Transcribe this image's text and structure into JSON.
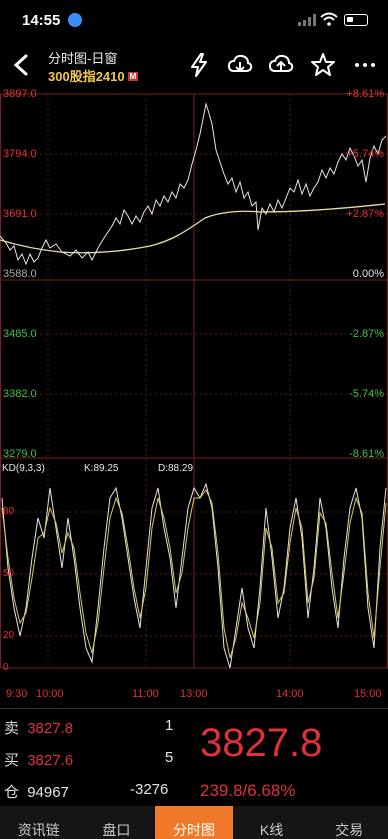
{
  "status": {
    "time": "14:55"
  },
  "header": {
    "title": "分时图-日窗",
    "subtitle": "300股指2410",
    "tag": "M"
  },
  "price_axis": {
    "left": [
      "3897.0",
      "3794.0",
      "3691.0",
      "3588.0",
      "3485.0",
      "3382.0",
      "3279.0"
    ],
    "right": [
      "+8.61%",
      "+5.74%",
      "+2.87%",
      "0.00%",
      "-2.87%",
      "-5.74%",
      "-8.61%"
    ]
  },
  "kd": {
    "label": "KD(9,3,3)",
    "k": "K:89.25",
    "d": "D:88.29",
    "levels": [
      "80",
      "50",
      "20",
      "0"
    ]
  },
  "time_axis": [
    "9:30",
    "10:00",
    "11:00",
    "13:00",
    "14:00",
    "15:00"
  ],
  "quote": {
    "sell_label": "卖",
    "sell_price": "3827.8",
    "sell_qty": "1",
    "buy_label": "买",
    "buy_price": "3827.6",
    "buy_qty": "5",
    "pos_label": "仓",
    "pos_value": "94967",
    "pos_change": "-3276",
    "last_price": "3827.8",
    "change": "239.8/6.68%"
  },
  "tabs": [
    "资讯链",
    "盘口",
    "分时图",
    "K线",
    "交易"
  ],
  "active_tab": 2,
  "colors": {
    "up": "#e0303a",
    "down": "#3cc24a",
    "accent": "#f07a2a",
    "avg_line": "#e8e0a0"
  },
  "chart_data": {
    "type": "line",
    "x": [
      "9:30",
      "10:00",
      "11:00",
      "13:00",
      "14:00",
      "15:00"
    ],
    "series": [],
    "ylim": [
      3279.0,
      3897.0
    ]
  }
}
